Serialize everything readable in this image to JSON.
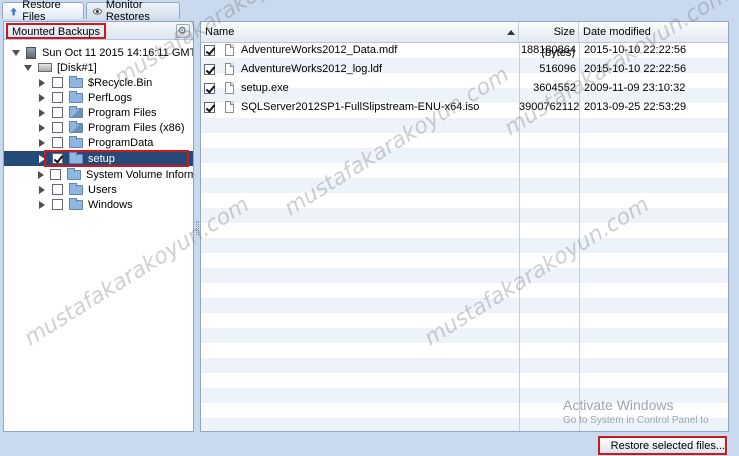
{
  "tabs": [
    {
      "label": "Restore Files",
      "icon": "restore-arrow-icon",
      "active": true
    },
    {
      "label": "Monitor Restores",
      "icon": "eye-icon",
      "active": false
    }
  ],
  "left_panel": {
    "title": "Mounted Backups",
    "tool_icon": "settings-icon",
    "backup_label": "Sun Oct 11 2015 14:16:11 GMT+...",
    "disk_label": "[Disk#1]",
    "folders": [
      {
        "label": "$Recycle.Bin",
        "checked": false
      },
      {
        "label": "PerfLogs",
        "checked": false
      },
      {
        "label": "Program Files",
        "checked": false
      },
      {
        "label": "Program Files (x86)",
        "checked": false
      },
      {
        "label": "ProgramData",
        "checked": false
      },
      {
        "label": "setup",
        "checked": true,
        "selected": true
      },
      {
        "label": "System Volume Informa...",
        "checked": false
      },
      {
        "label": "Users",
        "checked": false
      },
      {
        "label": "Windows",
        "checked": false
      }
    ]
  },
  "grid": {
    "columns": {
      "name": "Name",
      "size": "Size (bytes)",
      "date": "Date modified"
    },
    "rows": [
      {
        "name": "AdventureWorks2012_Data.mdf",
        "size": "188180864",
        "date": "2015-10-10 22:22:56",
        "checked": true
      },
      {
        "name": "AdventureWorks2012_log.ldf",
        "size": "516096",
        "date": "2015-10-10 22:22:56",
        "checked": true
      },
      {
        "name": "setup.exe",
        "size": "3604552",
        "date": "2009-11-09 23:10:32",
        "checked": true
      },
      {
        "name": "SQLServer2012SP1-FullSlipstream-ENU-x64.iso",
        "size": "3900762112",
        "date": "2013-09-25 22:53:29",
        "checked": true
      }
    ]
  },
  "restore_button": {
    "label": "Restore selected files...",
    "icon": "restore-arrow-icon"
  },
  "os_notice": {
    "title": "Activate Windows",
    "subtitle": "Go to System in Control Panel to"
  },
  "watermark": "mustafakarakoyun.com",
  "colors": {
    "accent_red": "#d01818",
    "selection": "#254a78",
    "frame": "#c9d9ee"
  }
}
